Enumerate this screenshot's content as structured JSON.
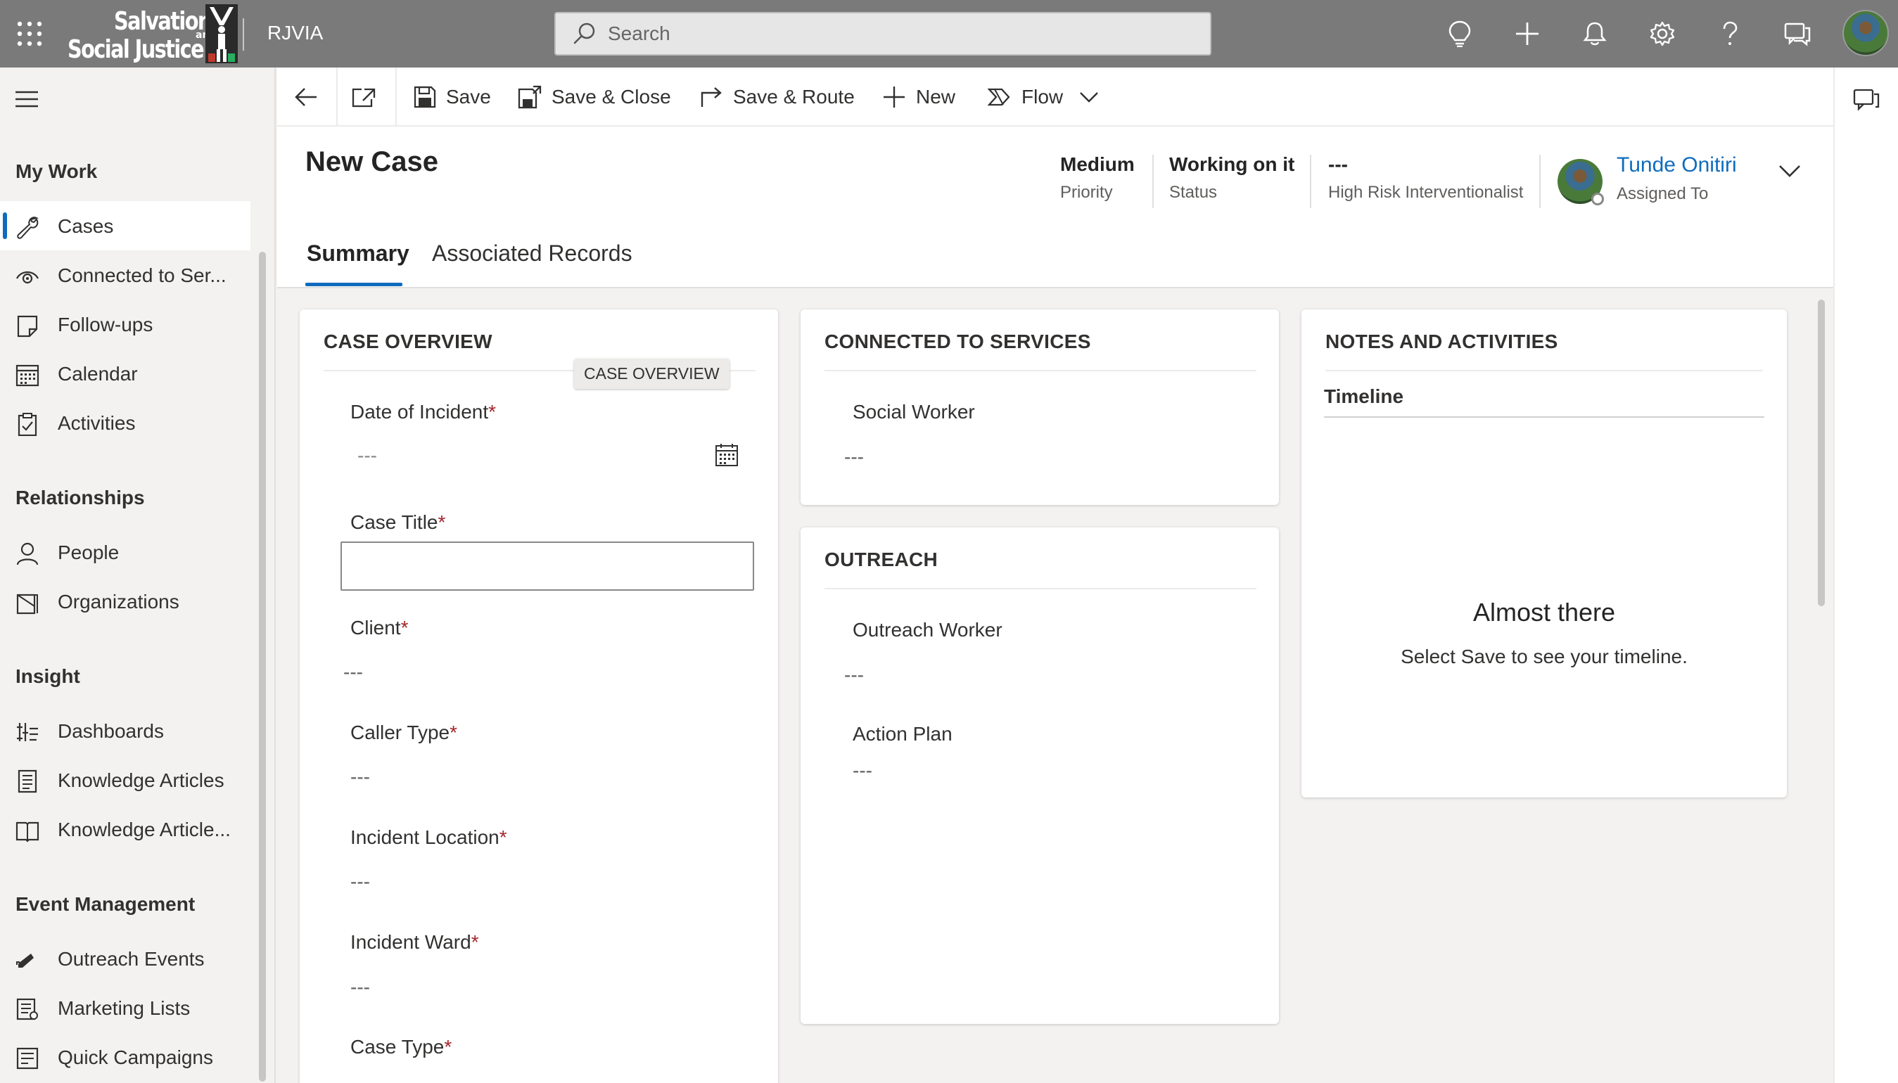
{
  "app": {
    "logo_line1": "Salvation",
    "logo_line2": "Social Justice",
    "logo_and": "and",
    "name": "RJVIA"
  },
  "search": {
    "placeholder": "Search"
  },
  "top_icons": [
    "lightbulb-icon",
    "plus-icon",
    "bell-icon",
    "gear-icon",
    "help-icon",
    "chat-icon"
  ],
  "sidebar": {
    "sections": [
      {
        "title": "My Work",
        "items": [
          {
            "label": "Cases",
            "icon": "wrench-icon",
            "active": true
          },
          {
            "label": "Connected to Ser...",
            "icon": "eye-icon"
          },
          {
            "label": "Follow-ups",
            "icon": "note-icon"
          },
          {
            "label": "Calendar",
            "icon": "calendar-icon"
          },
          {
            "label": "Activities",
            "icon": "clipboard-icon"
          }
        ]
      },
      {
        "title": "Relationships",
        "items": [
          {
            "label": "People",
            "icon": "person-icon"
          },
          {
            "label": "Organizations",
            "icon": "building-icon"
          }
        ]
      },
      {
        "title": "Insight",
        "items": [
          {
            "label": "Dashboards",
            "icon": "dashboard-icon"
          },
          {
            "label": "Knowledge Articles",
            "icon": "article-icon"
          },
          {
            "label": "Knowledge Article...",
            "icon": "book-icon"
          }
        ]
      },
      {
        "title": "Event Management",
        "items": [
          {
            "label": "Outreach Events",
            "icon": "megaphone-icon"
          },
          {
            "label": "Marketing Lists",
            "icon": "list-icon"
          },
          {
            "label": "Quick Campaigns",
            "icon": "campaign-icon"
          }
        ]
      }
    ]
  },
  "commandbar": {
    "save": "Save",
    "save_close": "Save & Close",
    "save_route": "Save & Route",
    "new": "New",
    "flow": "Flow"
  },
  "header": {
    "title": "New Case",
    "priority_value": "Medium",
    "priority_label": "Priority",
    "status_value": "Working on it",
    "status_label": "Status",
    "risk_value": "---",
    "risk_label": "High Risk Interventionalist",
    "assigned_name": "Tunde Onitiri",
    "assigned_label": "Assigned To"
  },
  "tabs": [
    {
      "label": "Summary",
      "active": true
    },
    {
      "label": "Associated Records",
      "active": false
    }
  ],
  "case_overview": {
    "title": "CASE OVERVIEW",
    "tooltip": "CASE OVERVIEW",
    "date_label": "Date of Incident",
    "date_placeholder": "---",
    "case_title_label": "Case Title",
    "case_title_value": "",
    "client_label": "Client",
    "client_value": "---",
    "caller_type_label": "Caller Type",
    "caller_type_value": "---",
    "incident_location_label": "Incident Location",
    "incident_location_value": "---",
    "incident_ward_label": "Incident Ward",
    "incident_ward_value": "---",
    "case_type_label": "Case Type",
    "required_mark": "*"
  },
  "connected_services": {
    "title": "CONNECTED TO SERVICES",
    "social_worker_label": "Social Worker",
    "social_worker_value": "---"
  },
  "outreach": {
    "title": "OUTREACH",
    "worker_label": "Outreach Worker",
    "worker_value": "---",
    "plan_label": "Action Plan",
    "plan_value": "---"
  },
  "notes": {
    "title": "NOTES AND ACTIVITIES",
    "timeline_label": "Timeline",
    "empty_title": "Almost there",
    "empty_subtitle": "Select Save to see your timeline."
  },
  "colors": {
    "topbar": "#7a7a7a",
    "accent": "#0f6cbd",
    "required": "#a4262c"
  }
}
